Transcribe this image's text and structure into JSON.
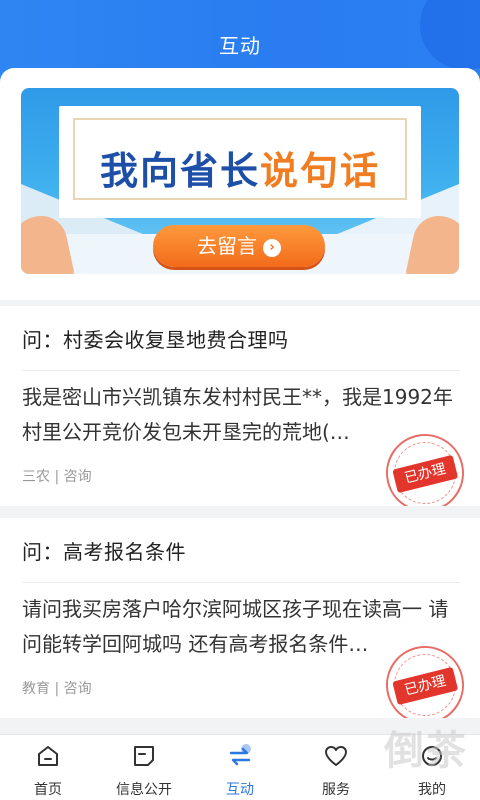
{
  "header": {
    "title": "互动"
  },
  "banner": {
    "headline_part1": "我向省长",
    "headline_part2": "说句话",
    "button_label": "去留言"
  },
  "questions": [
    {
      "question": "问：村委会收复垦地费合理吗",
      "body": "我是密山市兴凯镇东发村村民王**，我是1992年村里公开竞价发包未开垦完的荒地(…",
      "meta": "三农 | 咨询",
      "stamp": "已办理"
    },
    {
      "question": "问：高考报名条件",
      "body": "请问我买房落户哈尔滨阿城区孩子现在读高一 请问能转学回阿城吗 还有高考报名条件…",
      "meta": "教育 | 咨询",
      "stamp": "已办理"
    }
  ],
  "tabbar": {
    "items": [
      {
        "label": "首页",
        "icon": "home-icon"
      },
      {
        "label": "信息公开",
        "icon": "document-icon"
      },
      {
        "label": "互动",
        "icon": "interact-icon"
      },
      {
        "label": "服务",
        "icon": "service-icon"
      },
      {
        "label": "我的",
        "icon": "profile-icon"
      }
    ],
    "active": "互动"
  },
  "watermark": "倒茶",
  "colors": {
    "primary": "#2b78e4",
    "header": "#2f86f2",
    "banner_button": "#f26b1a",
    "stamp": "#e2352b"
  }
}
